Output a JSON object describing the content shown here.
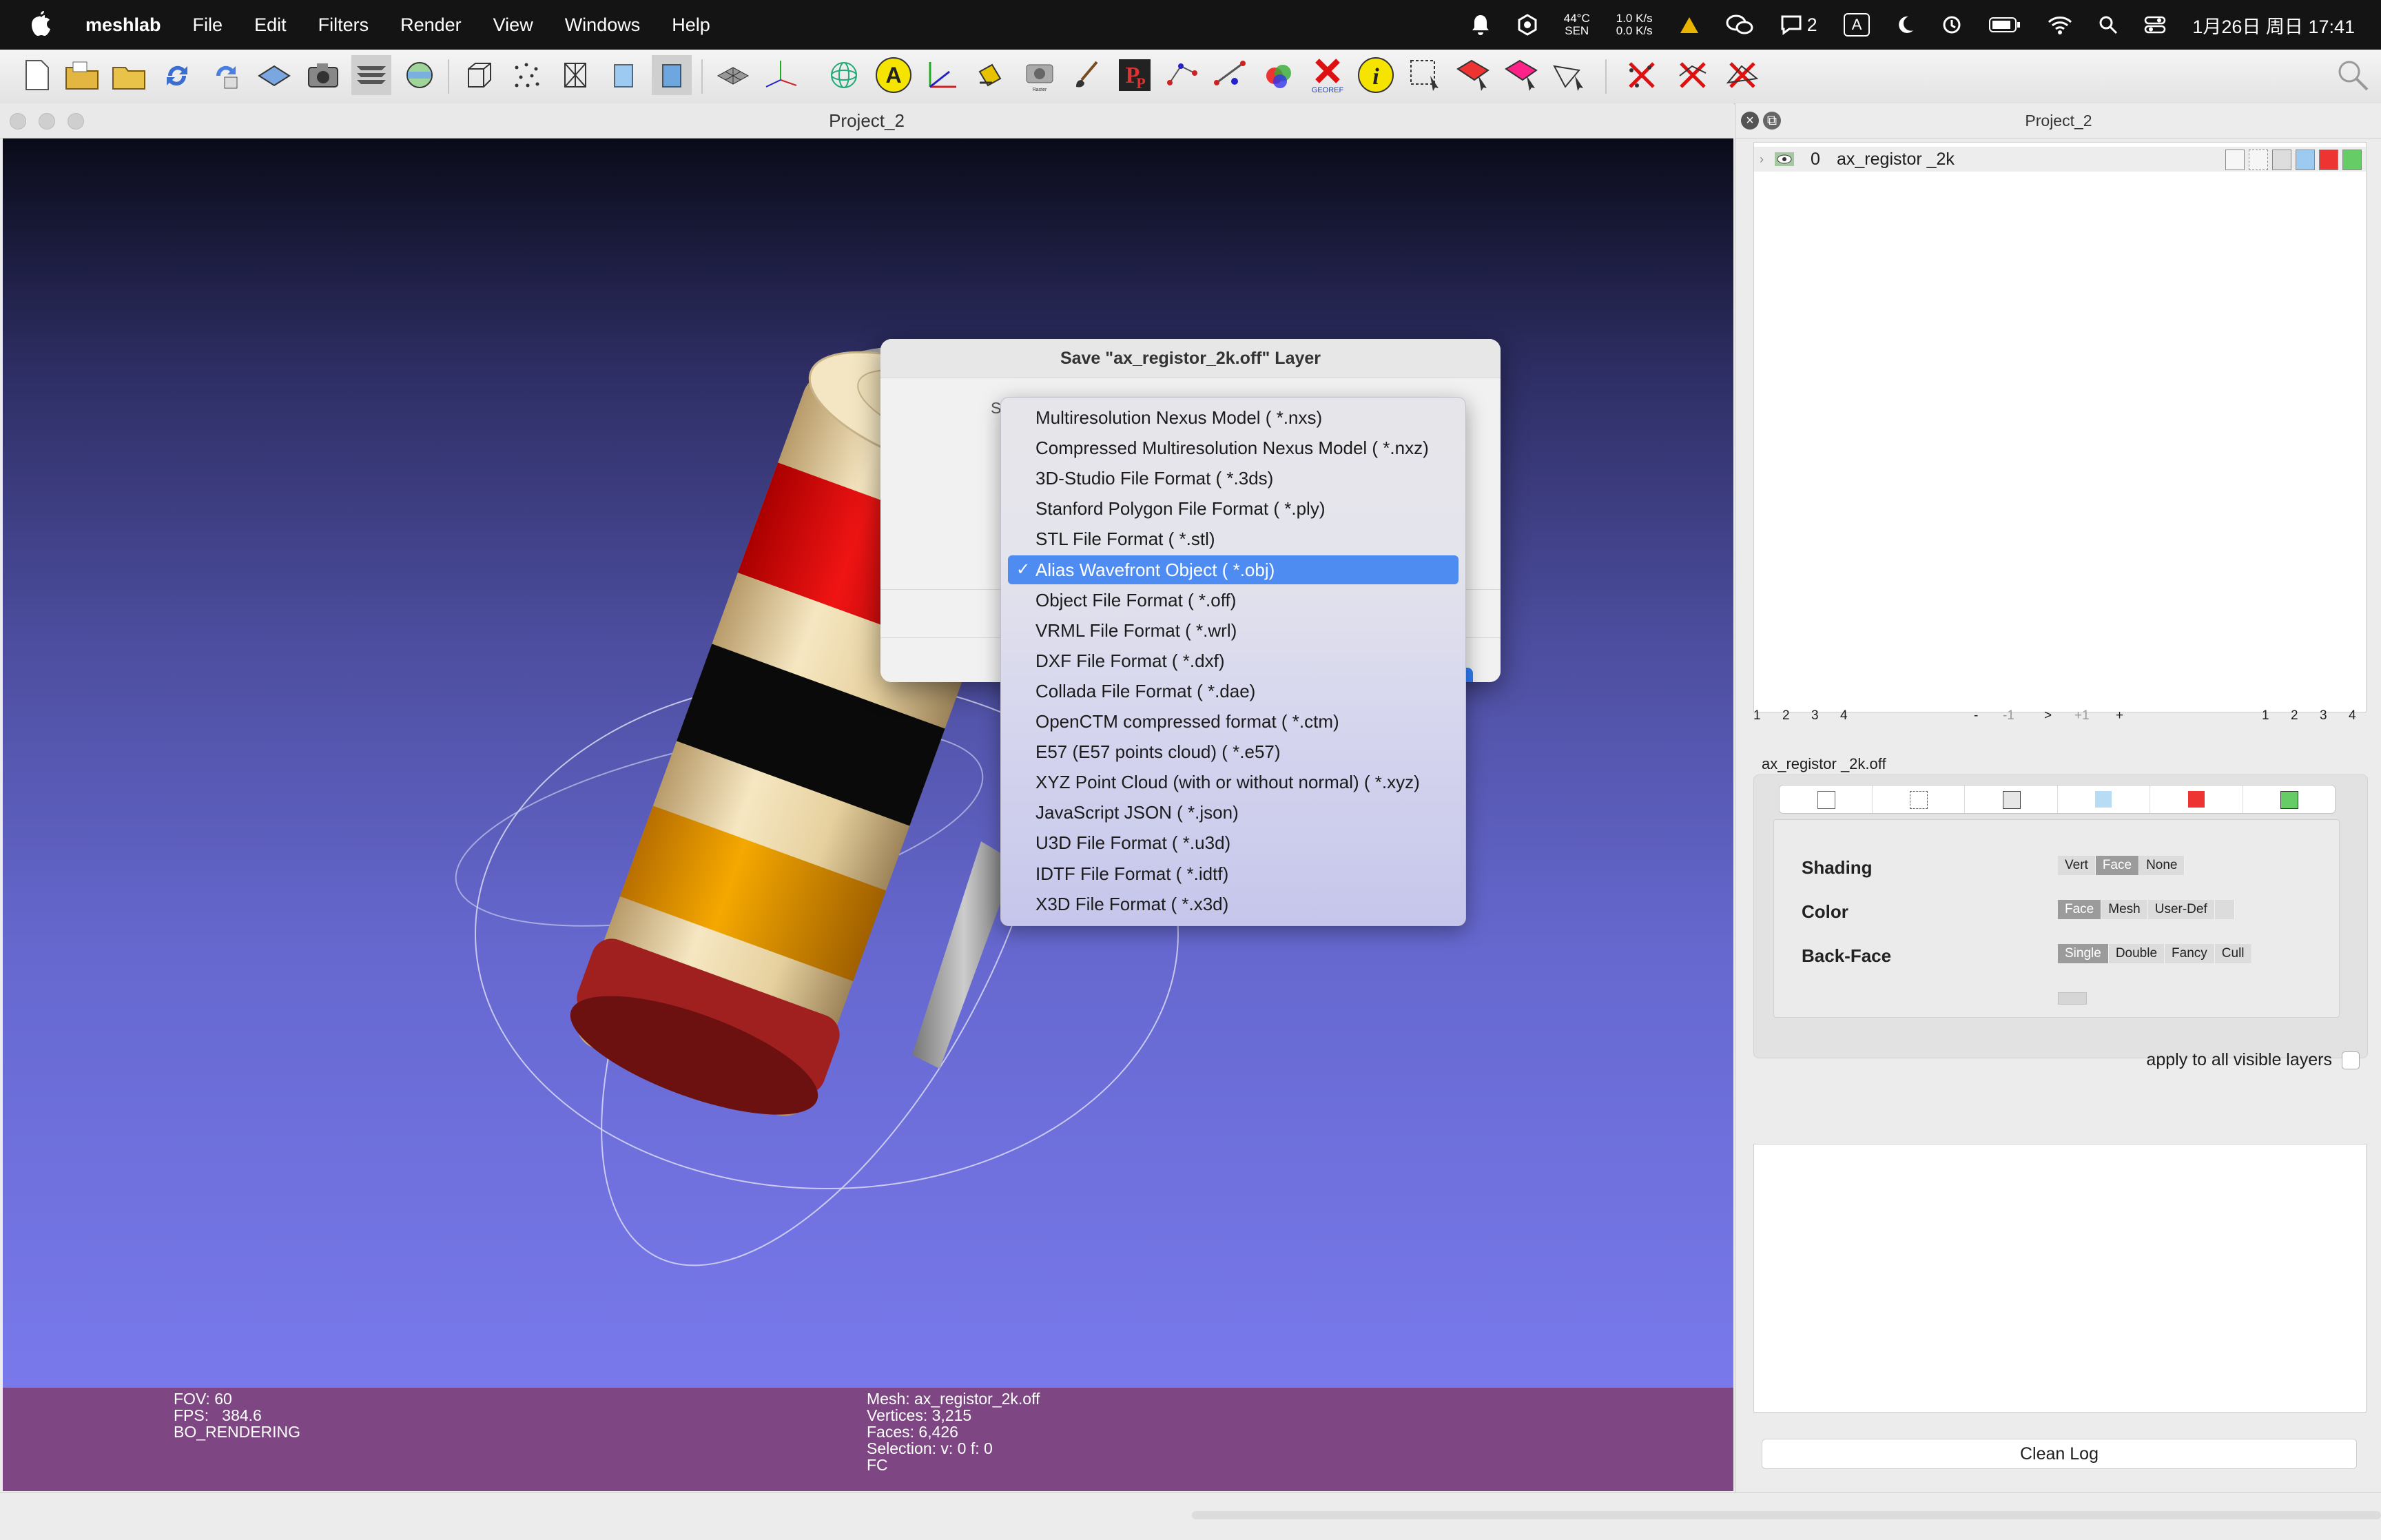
{
  "menubar": {
    "app_name": "meshlab",
    "menus": [
      "File",
      "Edit",
      "Filters",
      "Render",
      "View",
      "Windows",
      "Help"
    ],
    "status": {
      "temperature": "44°C",
      "temperature_sub": "SEN",
      "net_up": "1.0 K/s",
      "net_down": "0.0 K/s",
      "chat_count": "2",
      "input_method": "A",
      "clock": "1月26日 周日  17:41"
    }
  },
  "toolbar": {
    "georef_label": "GEOREF"
  },
  "project_window": {
    "title": "Project_2"
  },
  "info_bar": {
    "left": "FOV: 60\nFPS:   384.6\nBO_RENDERING",
    "right": "Mesh: ax_registor_2k.off\nVertices: 3,215\nFaces: 6,426\nSelection: v: 0 f: 0\nFC"
  },
  "right_panel": {
    "title": "Project_2",
    "layer": {
      "index": "0",
      "name": "ax_registor _2k"
    },
    "nav": {
      "left": [
        "1",
        "2",
        "3",
        "4"
      ],
      "center": [
        "-",
        "-1",
        ">",
        "+1",
        "+"
      ],
      "right": [
        "1",
        "2",
        "3",
        "4"
      ]
    },
    "mesh_label": "ax_registor _2k.off",
    "render": {
      "shading_label": "Shading",
      "shading_options": [
        "Vert",
        "Face",
        "None"
      ],
      "color_label": "Color",
      "color_options": [
        "Face",
        "Mesh",
        "User-Def"
      ],
      "backface_label": "Back-Face",
      "backface_options": [
        "Single",
        "Double",
        "Fancy",
        "Cull"
      ]
    },
    "apply_label": "apply to all visible layers",
    "clean_log_label": "Clean Log"
  },
  "save_dialog": {
    "title": "Save \"ax_registor_2k.off\" Layer",
    "partial_label": "S"
  },
  "format_menu": {
    "selected_index": 5,
    "items": [
      "Multiresolution Nexus Model ( *.nxs)",
      "Compressed Multiresolution Nexus Model ( *.nxz)",
      "3D-Studio File Format ( *.3ds)",
      "Stanford Polygon File Format ( *.ply)",
      "STL File Format ( *.stl)",
      "Alias Wavefront Object ( *.obj)",
      "Object File Format ( *.off)",
      "VRML File Format ( *.wrl)",
      "DXF File Format ( *.dxf)",
      "Collada File Format ( *.dae)",
      "OpenCTM compressed format ( *.ctm)",
      "E57 (E57 points cloud) ( *.e57)",
      "XYZ Point Cloud (with or without normal) ( *.xyz)",
      "JavaScript JSON ( *.json)",
      "U3D File Format ( *.u3d)",
      "IDTF File Format ( *.idtf)",
      "X3D File Format ( *.x3d)"
    ],
    "check_glyph": "✓"
  },
  "colors": {
    "menu_selection": "#4f8cf2",
    "info_bar": "#7e4783",
    "resistor_body": "#ecd9ad",
    "band_red": "#e01010",
    "band_black": "#0a0a0a",
    "band_orange": "#f0a000",
    "band_dark_red": "#a02020"
  }
}
